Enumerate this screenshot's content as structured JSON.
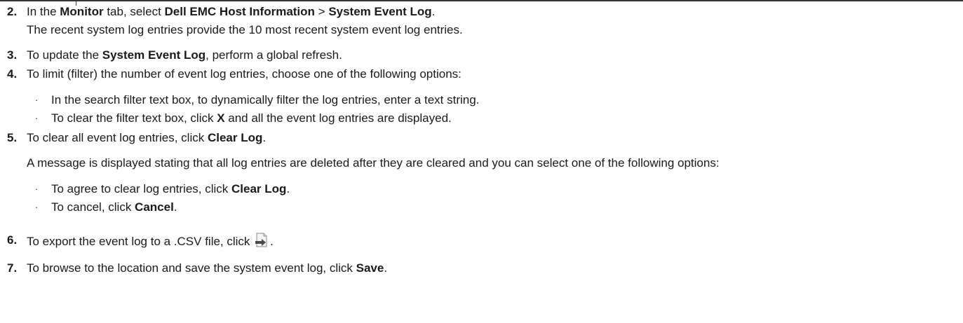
{
  "steps": {
    "s2": {
      "num": "2.",
      "a": "In the ",
      "b1": "Monitor",
      "c": " tab, select ",
      "b2": "Dell EMC Host Information",
      "d": " > ",
      "b3": "System Event Log",
      "e": ".",
      "sub": "The recent system log entries provide the 10 most recent system event log entries."
    },
    "s3": {
      "num": "3.",
      "a": "To update the ",
      "b1": "System Event Log",
      "c": ", perform a global refresh."
    },
    "s4": {
      "num": "4.",
      "a": "To limit (filter) the number of event log entries, choose one of the following options:",
      "bullet1": "In the search filter text box, to dynamically filter the log entries, enter a text string.",
      "bullet2_a": "To clear the filter text box, click ",
      "bullet2_b": "X",
      "bullet2_c": " and all the event log entries are displayed."
    },
    "s5": {
      "num": "5.",
      "a": "To clear all event log entries, click ",
      "b1": "Clear Log",
      "c": ".",
      "sub": "A message is displayed stating that all log entries are deleted after they are cleared and you can select one of the following options:",
      "bullet1_a": "To agree to clear log entries, click ",
      "bullet1_b": "Clear Log",
      "bullet1_c": ".",
      "bullet2_a": "To cancel, click ",
      "bullet2_b": "Cancel",
      "bullet2_c": "."
    },
    "s6": {
      "num": "6.",
      "a": "To export the event log to a .CSV file, click ",
      "c": ".",
      "icon": "export-csv-icon"
    },
    "s7": {
      "num": "7.",
      "a": "To browse to the location and save the system event log, click ",
      "b1": "Save",
      "c": "."
    }
  },
  "bullet_char": "·"
}
